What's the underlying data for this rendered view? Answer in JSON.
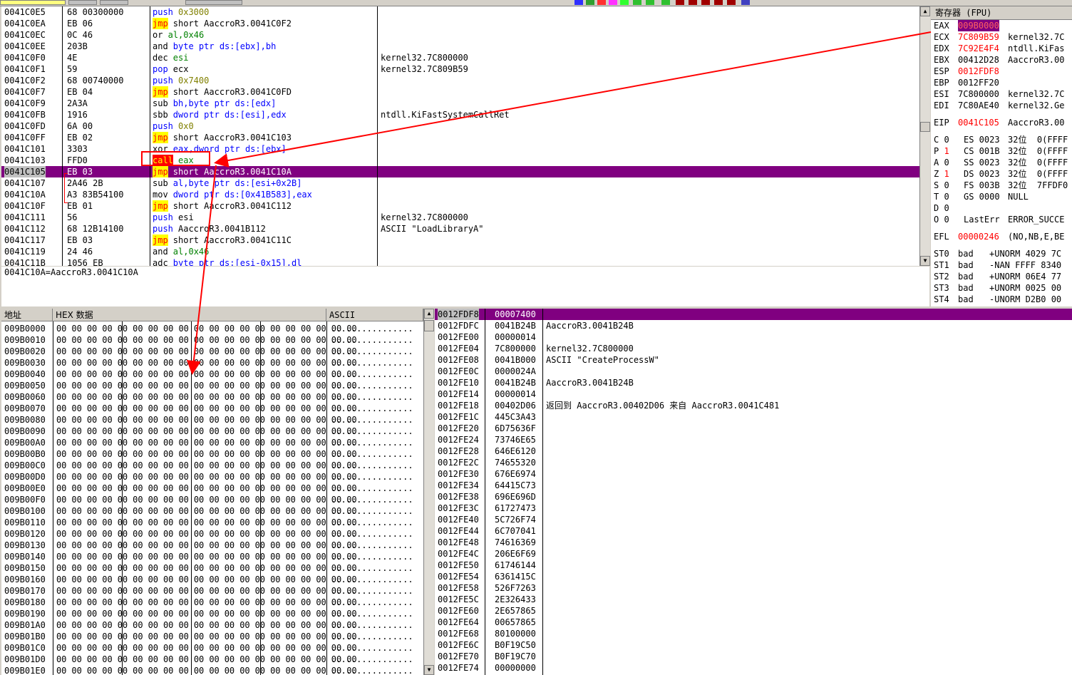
{
  "disasm": {
    "rows": [
      {
        "addr": "0041C0E5",
        "hex": "68 00300000",
        "mn": "push",
        "op": "0x3000",
        "cmt": "",
        "type": "push"
      },
      {
        "addr": "0041C0EA",
        "hex": "EB 06",
        "mn": "jmp",
        "op": "short AaccroR3.0041C0F2",
        "cmt": "",
        "type": "jmp"
      },
      {
        "addr": "0041C0EC",
        "hex": "0C 46",
        "mn": "or",
        "op": "al,0x46",
        "cmt": "",
        "type": "plain"
      },
      {
        "addr": "0041C0EE",
        "hex": "203B",
        "mn": "and",
        "op": "byte ptr ds:[ebx],bh",
        "cmt": "",
        "type": "plain"
      },
      {
        "addr": "0041C0F0",
        "hex": "4E",
        "mn": "dec",
        "op": "esi",
        "cmt": "kernel32.7C800000",
        "type": "plain"
      },
      {
        "addr": "0041C0F1",
        "hex": "59",
        "mn": "pop",
        "op": "ecx",
        "cmt": "kernel32.7C809B59",
        "type": "push"
      },
      {
        "addr": "0041C0F2",
        "hex": "68 00740000",
        "mn": "push",
        "op": "0x7400",
        "cmt": "",
        "type": "push"
      },
      {
        "addr": "0041C0F7",
        "hex": "EB 04",
        "mn": "jmp",
        "op": "short AaccroR3.0041C0FD",
        "cmt": "",
        "type": "jmp"
      },
      {
        "addr": "0041C0F9",
        "hex": "2A3A",
        "mn": "sub",
        "op": "bh,byte ptr ds:[edx]",
        "cmt": "",
        "type": "plain"
      },
      {
        "addr": "0041C0FB",
        "hex": "1916",
        "mn": "sbb",
        "op": "dword ptr ds:[esi],edx",
        "cmt": "ntdll.KiFastSystemCallRet",
        "type": "plain"
      },
      {
        "addr": "0041C0FD",
        "hex": "6A 00",
        "mn": "push",
        "op": "0x0",
        "cmt": "",
        "type": "push"
      },
      {
        "addr": "0041C0FF",
        "hex": "EB 02",
        "mn": "jmp",
        "op": "short AaccroR3.0041C103",
        "cmt": "",
        "type": "jmp"
      },
      {
        "addr": "0041C101",
        "hex": "3303",
        "mn": "xor",
        "op": "eax,dword ptr ds:[ebx]",
        "cmt": "",
        "type": "plain"
      },
      {
        "addr": "0041C103",
        "hex": "FFD0",
        "mn": "call",
        "op": "eax",
        "cmt": "",
        "type": "call"
      },
      {
        "addr": "0041C105",
        "hex": "EB 03",
        "mn": "jmp",
        "op": "short AaccroR3.0041C10A",
        "cmt": "",
        "type": "sel"
      },
      {
        "addr": "0041C107",
        "hex": "2A46 2B",
        "mn": "sub",
        "op": "al,byte ptr ds:[esi+0x2B]",
        "cmt": "",
        "type": "plain"
      },
      {
        "addr": "0041C10A",
        "hex": "A3 83B54100",
        "mn": "mov",
        "op": "dword ptr ds:[0x41B583],eax",
        "cmt": "",
        "type": "plain"
      },
      {
        "addr": "0041C10F",
        "hex": "EB 01",
        "mn": "jmp",
        "op": "short AaccroR3.0041C112",
        "cmt": "",
        "type": "jmp"
      },
      {
        "addr": "0041C111",
        "hex": "56",
        "mn": "push",
        "op": "esi",
        "cmt": "kernel32.7C800000",
        "type": "push"
      },
      {
        "addr": "0041C112",
        "hex": "68 12B14100",
        "mn": "push",
        "op": "AaccroR3.0041B112",
        "cmt": "ASCII \"LoadLibraryA\"",
        "type": "push"
      },
      {
        "addr": "0041C117",
        "hex": "EB 03",
        "mn": "jmp",
        "op": "short AaccroR3.0041C11C",
        "cmt": "",
        "type": "jmp"
      },
      {
        "addr": "0041C119",
        "hex": "24 46",
        "mn": "and",
        "op": "al,0x46",
        "cmt": "",
        "type": "plain"
      },
      {
        "addr": "0041C11B",
        "hex": "1056 EB",
        "mn": "adc",
        "op": "byte ptr ds:[esi-0x15],dl",
        "cmt": "",
        "type": "plain"
      }
    ]
  },
  "info_line": "0041C10A=AaccroR3.0041C10A",
  "registers": {
    "header": "寄存器 (FPU)",
    "rows": [
      {
        "name": "EAX",
        "val": "009B0000",
        "desc": "",
        "style": "sel"
      },
      {
        "name": "ECX",
        "val": "7C809B59",
        "desc": "kernel32.7C",
        "style": "red"
      },
      {
        "name": "EDX",
        "val": "7C92E4F4",
        "desc": "ntdll.KiFas",
        "style": "red"
      },
      {
        "name": "EBX",
        "val": "00412D28",
        "desc": "AaccroR3.00",
        "style": ""
      },
      {
        "name": "ESP",
        "val": "0012FDF8",
        "desc": "",
        "style": "red"
      },
      {
        "name": "EBP",
        "val": "0012FF20",
        "desc": "",
        "style": ""
      },
      {
        "name": "ESI",
        "val": "7C800000",
        "desc": "kernel32.7C",
        "style": ""
      },
      {
        "name": "EDI",
        "val": "7C80AE40",
        "desc": "kernel32.Ge",
        "style": ""
      },
      {
        "name": "",
        "val": "",
        "desc": "",
        "style": "gap"
      },
      {
        "name": "EIP",
        "val": "0041C105",
        "desc": "AaccroR3.00",
        "style": "red"
      },
      {
        "name": "",
        "val": "",
        "desc": "",
        "style": "gap"
      },
      {
        "name": "C 0",
        "val": "ES 0023",
        "desc": "32位  0(FFFF",
        "style": "flag"
      },
      {
        "name": "P 1",
        "val": "CS 001B",
        "desc": "32位  0(FFFF",
        "style": "flagred"
      },
      {
        "name": "A 0",
        "val": "SS 0023",
        "desc": "32位  0(FFFF",
        "style": "flag"
      },
      {
        "name": "Z 1",
        "val": "DS 0023",
        "desc": "32位  0(FFFF",
        "style": "flagred"
      },
      {
        "name": "S 0",
        "val": "FS 003B",
        "desc": "32位  7FFDF0",
        "style": "flag"
      },
      {
        "name": "T 0",
        "val": "GS 0000",
        "desc": "NULL",
        "style": "flag"
      },
      {
        "name": "D 0",
        "val": "",
        "desc": "",
        "style": "flag"
      },
      {
        "name": "O 0",
        "val": "LastErr",
        "desc": "ERROR_SUCCE",
        "style": "flag"
      },
      {
        "name": "",
        "val": "",
        "desc": "",
        "style": "gap"
      },
      {
        "name": "EFL",
        "val": "00000246",
        "desc": "(NO,NB,E,BE",
        "style": "red"
      },
      {
        "name": "",
        "val": "",
        "desc": "",
        "style": "gap"
      },
      {
        "name": "ST0",
        "val": "bad",
        "desc": "+UNORM 4029 7C",
        "style": "fpu"
      },
      {
        "name": "ST1",
        "val": "bad",
        "desc": "-NAN FFFF 8340",
        "style": "fpu"
      },
      {
        "name": "ST2",
        "val": "bad",
        "desc": "+UNORM 06E4 77",
        "style": "fpu"
      },
      {
        "name": "ST3",
        "val": "bad",
        "desc": "+UNORM 0025 00",
        "style": "fpu"
      },
      {
        "name": "ST4",
        "val": "bad",
        "desc": "-UNORM D2B0 00",
        "style": "fpu"
      }
    ]
  },
  "dump": {
    "col_addr": "地址",
    "col_hex": "HEX 数据",
    "col_ascii": "ASCII",
    "hex_bytes": "00 00 00 00 00 00 00 00 00 00 00 00 00 00 00 00 00 00 00 00",
    "ascii": "................",
    "addrs": [
      "009B0000",
      "009B0010",
      "009B0020",
      "009B0030",
      "009B0040",
      "009B0050",
      "009B0060",
      "009B0070",
      "009B0080",
      "009B0090",
      "009B00A0",
      "009B00B0",
      "009B00C0",
      "009B00D0",
      "009B00E0",
      "009B00F0",
      "009B0100",
      "009B0110",
      "009B0120",
      "009B0130",
      "009B0140",
      "009B0150",
      "009B0160",
      "009B0170",
      "009B0180",
      "009B0190",
      "009B01A0",
      "009B01B0",
      "009B01C0",
      "009B01D0",
      "009B01E0"
    ]
  },
  "stack": {
    "rows": [
      {
        "addr": "0012FDF8",
        "val": "00007400",
        "cmt": "",
        "sel": true
      },
      {
        "addr": "0012FDFC",
        "val": "0041B24B",
        "cmt": "AaccroR3.0041B24B"
      },
      {
        "addr": "0012FE00",
        "val": "00000014",
        "cmt": ""
      },
      {
        "addr": "0012FE04",
        "val": "7C800000",
        "cmt": "kernel32.7C800000"
      },
      {
        "addr": "0012FE08",
        "val": "0041B000",
        "cmt": "ASCII \"CreateProcessW\""
      },
      {
        "addr": "0012FE0C",
        "val": "0000024A",
        "cmt": ""
      },
      {
        "addr": "0012FE10",
        "val": "0041B24B",
        "cmt": "AaccroR3.0041B24B"
      },
      {
        "addr": "0012FE14",
        "val": "00000014",
        "cmt": ""
      },
      {
        "addr": "0012FE18",
        "val": "00402D06",
        "cmt": "返回到 AaccroR3.00402D06 来自 AaccroR3.0041C481"
      },
      {
        "addr": "0012FE1C",
        "val": "445C3A43",
        "cmt": ""
      },
      {
        "addr": "0012FE20",
        "val": "6D75636F",
        "cmt": ""
      },
      {
        "addr": "0012FE24",
        "val": "73746E65",
        "cmt": ""
      },
      {
        "addr": "0012FE28",
        "val": "646E6120",
        "cmt": ""
      },
      {
        "addr": "0012FE2C",
        "val": "74655320",
        "cmt": ""
      },
      {
        "addr": "0012FE30",
        "val": "676E6974",
        "cmt": ""
      },
      {
        "addr": "0012FE34",
        "val": "64415C73",
        "cmt": ""
      },
      {
        "addr": "0012FE38",
        "val": "696E696D",
        "cmt": ""
      },
      {
        "addr": "0012FE3C",
        "val": "61727473",
        "cmt": ""
      },
      {
        "addr": "0012FE40",
        "val": "5C726F74",
        "cmt": ""
      },
      {
        "addr": "0012FE44",
        "val": "6C707041",
        "cmt": ""
      },
      {
        "addr": "0012FE48",
        "val": "74616369",
        "cmt": ""
      },
      {
        "addr": "0012FE4C",
        "val": "206E6F69",
        "cmt": ""
      },
      {
        "addr": "0012FE50",
        "val": "61746144",
        "cmt": ""
      },
      {
        "addr": "0012FE54",
        "val": "6361415C",
        "cmt": ""
      },
      {
        "addr": "0012FE58",
        "val": "526F7263",
        "cmt": ""
      },
      {
        "addr": "0012FE5C",
        "val": "2E326433",
        "cmt": ""
      },
      {
        "addr": "0012FE60",
        "val": "2E657865",
        "cmt": ""
      },
      {
        "addr": "0012FE64",
        "val": "00657865",
        "cmt": ""
      },
      {
        "addr": "0012FE68",
        "val": "80100000",
        "cmt": ""
      },
      {
        "addr": "0012FE6C",
        "val": "B0F19C50",
        "cmt": ""
      },
      {
        "addr": "0012FE70",
        "val": "B0F19C70",
        "cmt": ""
      },
      {
        "addr": "0012FE74",
        "val": "00000000",
        "cmt": ""
      }
    ]
  },
  "colors": {
    "selection": "#800080",
    "accent": "#ff0000",
    "keyword_bg": "#ffff00",
    "link": "#0000ff"
  }
}
